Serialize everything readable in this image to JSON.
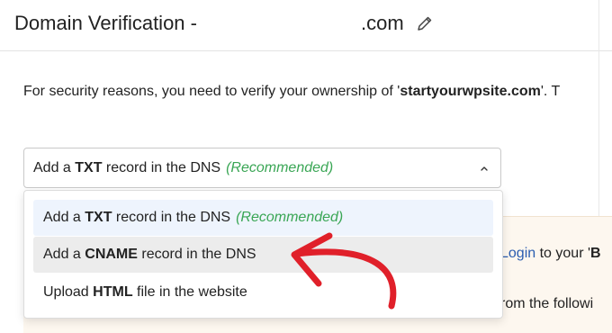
{
  "header": {
    "title": "Domain Verification -",
    "domain_suffix": ".com"
  },
  "description": {
    "prefix": "For security reasons, you need to verify your ownership of '",
    "domain": "startyourwpsite.com",
    "suffix": "'. T"
  },
  "select": {
    "selected": {
      "pre": "Add a ",
      "bold": "TXT",
      "post": " record in the DNS",
      "tag": "(Recommended)"
    }
  },
  "menu": {
    "items": [
      {
        "pre": "Add a ",
        "bold": "TXT",
        "post": " record in the DNS",
        "tag": "(Recommended)"
      },
      {
        "pre": "Add a ",
        "bold": "CNAME",
        "post": " record in the DNS"
      },
      {
        "pre": "Upload ",
        "bold": "HTML",
        "post": " file in the website"
      }
    ]
  },
  "background_text": {
    "line1_link": "Login",
    "line1_mid": " to your '",
    "line1_bold": "B",
    "line2": "rom the followi"
  },
  "colors": {
    "recommended": "#3aa655",
    "link": "#2a5db0",
    "annotation_arrow": "#e0202a",
    "highlight_hover": "#ececec",
    "highlight_selected": "#eef4fd",
    "panel_bg": "#fdf7ef"
  },
  "icons": {
    "edit": "pencil-icon",
    "select_toggle": "chevron-up-icon",
    "annotation": "curved-arrow-annotation"
  }
}
